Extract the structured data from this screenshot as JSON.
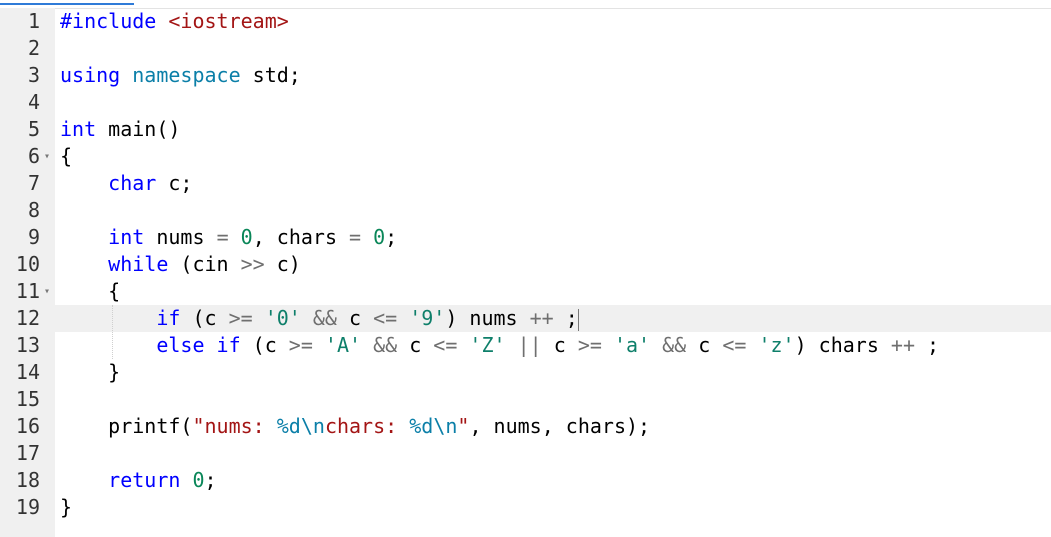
{
  "editor": {
    "active_line": 12,
    "lines": [
      {
        "n": "1",
        "tokens": [
          {
            "t": "#include ",
            "c": "kw"
          },
          {
            "t": "<iostream>",
            "c": "str"
          }
        ]
      },
      {
        "n": "2",
        "tokens": []
      },
      {
        "n": "3",
        "tokens": [
          {
            "t": "using ",
            "c": "kw"
          },
          {
            "t": "namespace ",
            "c": "ns"
          },
          {
            "t": "std;",
            "c": "txt"
          }
        ]
      },
      {
        "n": "4",
        "tokens": []
      },
      {
        "n": "5",
        "tokens": [
          {
            "t": "int ",
            "c": "kw"
          },
          {
            "t": "main()",
            "c": "txt"
          }
        ]
      },
      {
        "n": "6",
        "fold": "▾",
        "tokens": [
          {
            "t": "{",
            "c": "txt"
          }
        ]
      },
      {
        "n": "7",
        "tokens": [
          {
            "t": "    ",
            "c": "txt"
          },
          {
            "t": "char ",
            "c": "kw"
          },
          {
            "t": "c;",
            "c": "txt"
          }
        ]
      },
      {
        "n": "8",
        "tokens": []
      },
      {
        "n": "9",
        "tokens": [
          {
            "t": "    ",
            "c": "txt"
          },
          {
            "t": "int ",
            "c": "kw"
          },
          {
            "t": "nums ",
            "c": "txt"
          },
          {
            "t": "= ",
            "c": "op"
          },
          {
            "t": "0",
            "c": "num"
          },
          {
            "t": ", chars ",
            "c": "txt"
          },
          {
            "t": "= ",
            "c": "op"
          },
          {
            "t": "0",
            "c": "num"
          },
          {
            "t": ";",
            "c": "txt"
          }
        ]
      },
      {
        "n": "10",
        "tokens": [
          {
            "t": "    ",
            "c": "txt"
          },
          {
            "t": "while ",
            "c": "kw"
          },
          {
            "t": "(cin ",
            "c": "txt"
          },
          {
            "t": ">> ",
            "c": "op"
          },
          {
            "t": "c)",
            "c": "txt"
          }
        ]
      },
      {
        "n": "11",
        "fold": "▾",
        "tokens": [
          {
            "t": "    {",
            "c": "txt"
          }
        ]
      },
      {
        "n": "12",
        "tokens": [
          {
            "t": "        ",
            "c": "txt"
          },
          {
            "t": "if ",
            "c": "kw"
          },
          {
            "t": "(c ",
            "c": "txt"
          },
          {
            "t": ">= ",
            "c": "op"
          },
          {
            "t": "'0'",
            "c": "chr"
          },
          {
            "t": " ",
            "c": "txt"
          },
          {
            "t": "&& ",
            "c": "op"
          },
          {
            "t": "c ",
            "c": "txt"
          },
          {
            "t": "<= ",
            "c": "op"
          },
          {
            "t": "'9'",
            "c": "chr"
          },
          {
            "t": ") nums ",
            "c": "txt"
          },
          {
            "t": "++ ",
            "c": "op"
          },
          {
            "t": ";",
            "c": "txt"
          }
        ],
        "caret": true
      },
      {
        "n": "13",
        "tokens": [
          {
            "t": "        ",
            "c": "txt"
          },
          {
            "t": "else if ",
            "c": "kw"
          },
          {
            "t": "(c ",
            "c": "txt"
          },
          {
            "t": ">= ",
            "c": "op"
          },
          {
            "t": "'A'",
            "c": "chr"
          },
          {
            "t": " ",
            "c": "txt"
          },
          {
            "t": "&& ",
            "c": "op"
          },
          {
            "t": "c ",
            "c": "txt"
          },
          {
            "t": "<= ",
            "c": "op"
          },
          {
            "t": "'Z'",
            "c": "chr"
          },
          {
            "t": " ",
            "c": "txt"
          },
          {
            "t": "|| ",
            "c": "op"
          },
          {
            "t": "c ",
            "c": "txt"
          },
          {
            "t": ">= ",
            "c": "op"
          },
          {
            "t": "'a'",
            "c": "chr"
          },
          {
            "t": " ",
            "c": "txt"
          },
          {
            "t": "&& ",
            "c": "op"
          },
          {
            "t": "c ",
            "c": "txt"
          },
          {
            "t": "<= ",
            "c": "op"
          },
          {
            "t": "'z'",
            "c": "chr"
          },
          {
            "t": ") chars ",
            "c": "txt"
          },
          {
            "t": "++ ",
            "c": "op"
          },
          {
            "t": ";",
            "c": "txt"
          }
        ]
      },
      {
        "n": "14",
        "tokens": [
          {
            "t": "    }",
            "c": "txt"
          }
        ]
      },
      {
        "n": "15",
        "tokens": []
      },
      {
        "n": "16",
        "tokens": [
          {
            "t": "    printf(",
            "c": "txt"
          },
          {
            "t": "\"nums: ",
            "c": "str"
          },
          {
            "t": "%d",
            "c": "ns"
          },
          {
            "t": "\\n",
            "c": "ns"
          },
          {
            "t": "chars: ",
            "c": "str"
          },
          {
            "t": "%d",
            "c": "ns"
          },
          {
            "t": "\\n",
            "c": "ns"
          },
          {
            "t": "\"",
            "c": "str"
          },
          {
            "t": ", nums, chars);",
            "c": "txt"
          }
        ]
      },
      {
        "n": "17",
        "tokens": []
      },
      {
        "n": "18",
        "tokens": [
          {
            "t": "    ",
            "c": "txt"
          },
          {
            "t": "return ",
            "c": "kw"
          },
          {
            "t": "0",
            "c": "num"
          },
          {
            "t": ";",
            "c": "txt"
          }
        ]
      },
      {
        "n": "19",
        "tokens": [
          {
            "t": "}",
            "c": "txt"
          }
        ]
      }
    ]
  }
}
